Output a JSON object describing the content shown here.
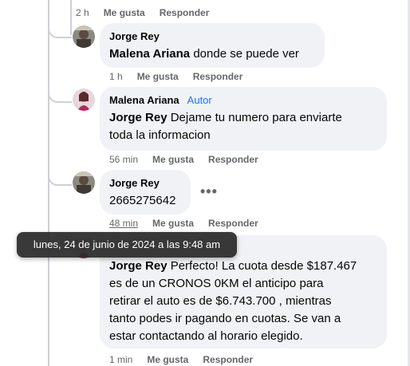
{
  "top_actions": {
    "time": "2 h",
    "like": "Me gusta",
    "reply": "Responder"
  },
  "comments": [
    {
      "author": "Jorge Rey",
      "mention": "Malena Ariana",
      "text": " donde se puede ver",
      "time": "1 h",
      "like": "Me gusta",
      "reply": "Responder"
    },
    {
      "author": "Malena Ariana",
      "badge": "Autor",
      "mention": "Jorge Rey",
      "text": " Dejame tu numero para enviarte",
      "text2": "toda la informacion",
      "time": "56 min",
      "like": "Me gusta",
      "reply": "Responder"
    },
    {
      "author": "Jorge Rey",
      "text": "2665275642",
      "more": "•••",
      "time": "48 min",
      "like": "Me gusta",
      "reply": "Responder"
    },
    {
      "mention": "Jorge Rey",
      "lines": [
        " Perfecto! La cuota desde $187.467",
        "es de un CRONOS 0KM el anticipo para",
        "retirar el auto es de $6.743.700 , mientras",
        "tanto podes ir pagando en cuotas. Se van a",
        "estar contactando al horario elegido."
      ],
      "time": "1 min",
      "like": "Me gusta",
      "reply": "Responder"
    }
  ],
  "tooltip": "lunes, 24 de junio de 2024 a las 9:48 am",
  "colors": {
    "bubble": "#f0f2f5",
    "meta": "#65676b",
    "accent": "#1877f2"
  }
}
